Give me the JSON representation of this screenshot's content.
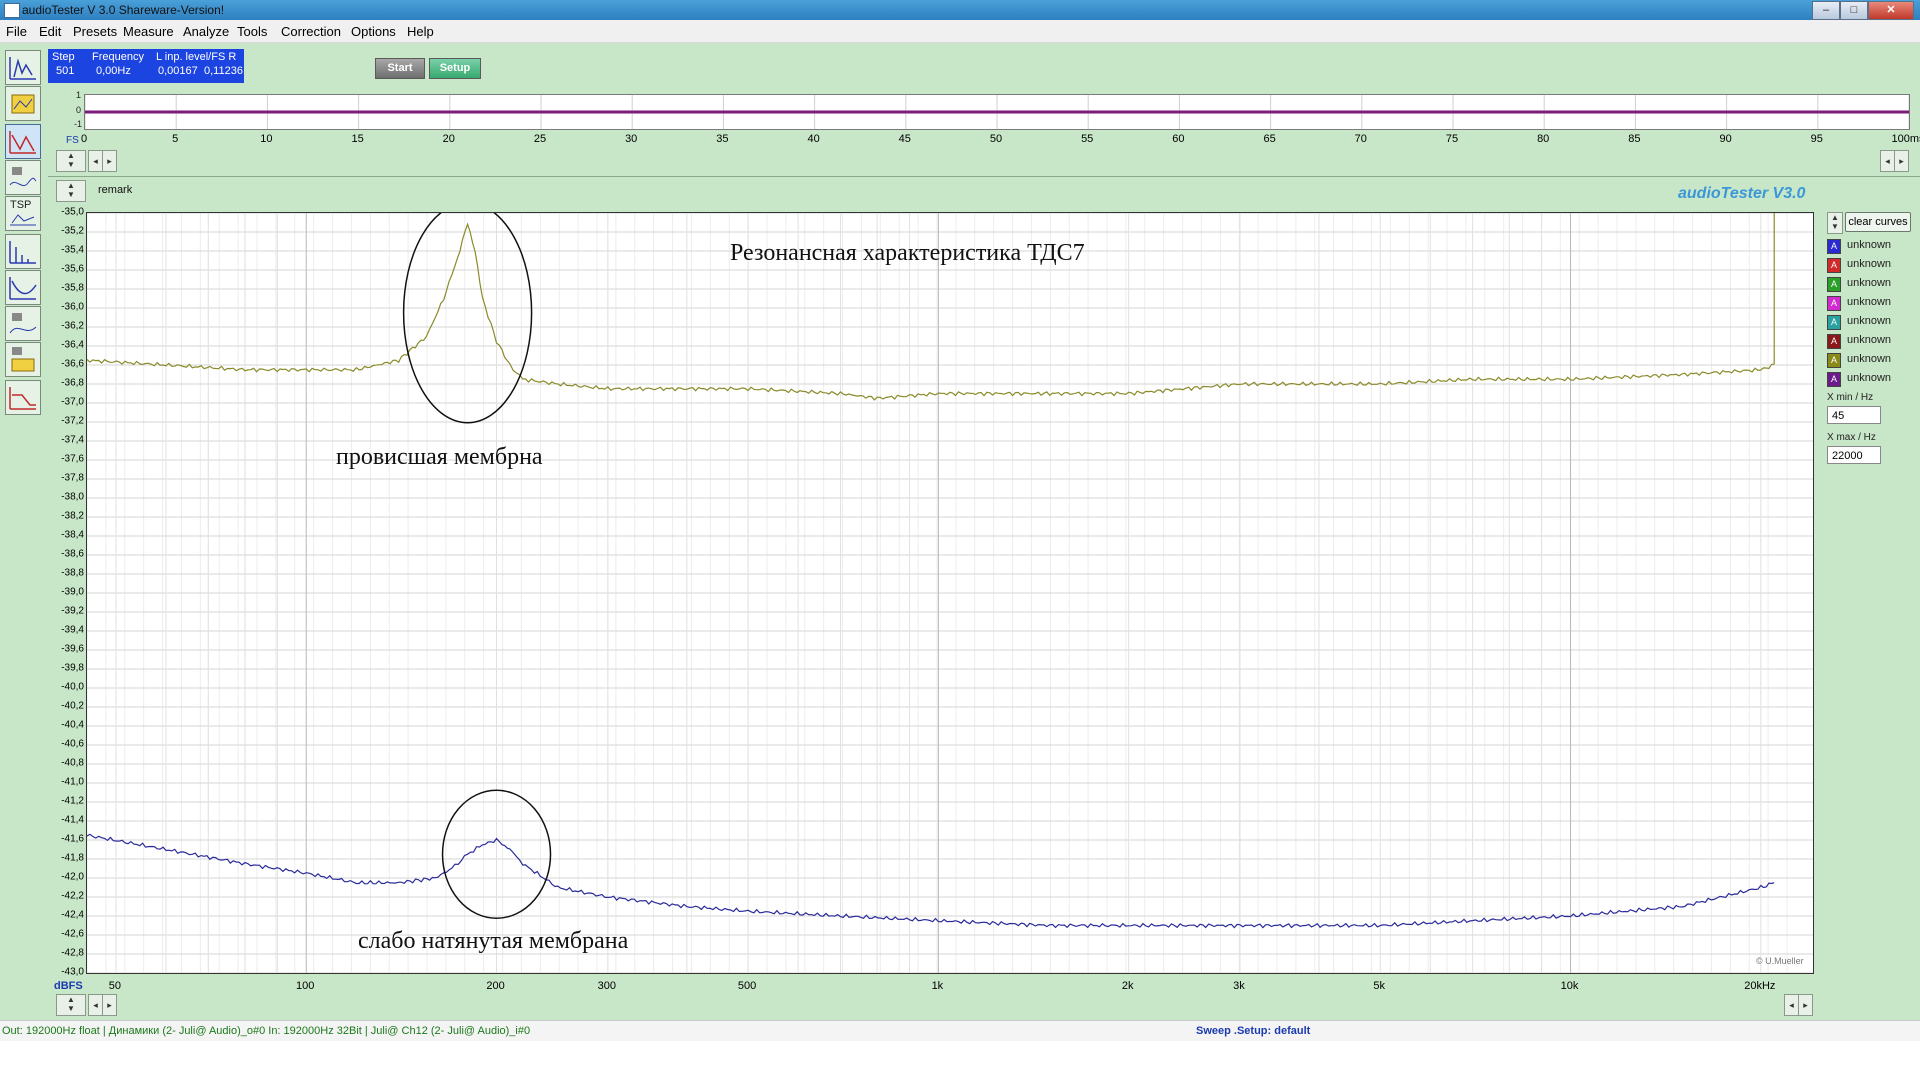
{
  "window": {
    "title": "audioTester  V 3.0 Shareware-Version!",
    "minimize": "–",
    "maximize": "□",
    "close": "✕"
  },
  "menu": [
    "File",
    "Edit",
    "Presets",
    "Measure",
    "Analyze",
    "Tools",
    "Correction",
    "Options",
    "Help"
  ],
  "toolbar_left": {
    "tsp_label": "TSP"
  },
  "info": {
    "step_label": "Step",
    "step_value": "501",
    "freq_label": "Frequency",
    "freq_value": "0,00Hz",
    "level_label": "L  inp. level/FS  R",
    "level_l": "0,00167",
    "level_r": "0,11236"
  },
  "buttons": {
    "start": "Start",
    "setup": "Setup"
  },
  "scope": {
    "y_top": "1",
    "y_mid": "0",
    "y_bottom": "-1",
    "fs_label": "FS",
    "time_ticks": [
      "0",
      "5",
      "10",
      "15",
      "20",
      "25",
      "30",
      "35",
      "40",
      "45",
      "50",
      "55",
      "60",
      "65",
      "70",
      "75",
      "80",
      "85",
      "90",
      "95",
      "100ms"
    ]
  },
  "remark": "remark",
  "brand": "audioTester  V3.0",
  "chart_data": {
    "type": "line",
    "title": "Резонансная характеристика ТДС7",
    "xlabel": "",
    "ylabel": "dBFS",
    "x_scale": "log",
    "xlim": [
      45,
      22000
    ],
    "ylim": [
      -43.0,
      -35.0
    ],
    "x_tick_labels": [
      "50",
      "100",
      "200",
      "300",
      "500",
      "1k",
      "2k",
      "3k",
      "5k",
      "10k",
      "20kHz"
    ],
    "x_tick_values": [
      50,
      100,
      200,
      300,
      500,
      1000,
      2000,
      3000,
      5000,
      10000,
      20000
    ],
    "y_tick_labels": [
      "-35,0",
      "-35,2",
      "-35,4",
      "-35,6",
      "-35,8",
      "-36,0",
      "-36,2",
      "-36,4",
      "-36,6",
      "-36,8",
      "-37,0",
      "-37,2",
      "-37,4",
      "-37,6",
      "-37,8",
      "-38,0",
      "-38,2",
      "-38,4",
      "-38,6",
      "-38,8",
      "-39,0",
      "-39,2",
      "-39,4",
      "-39,6",
      "-39,8",
      "-40,0",
      "-40,2",
      "-40,4",
      "-40,6",
      "-40,8",
      "-41,0",
      "-41,2",
      "-41,4",
      "-41,6",
      "-41,8",
      "-42,0",
      "-42,2",
      "-42,4",
      "-42,6",
      "-42,8",
      "-43,0"
    ],
    "series": [
      {
        "color": "#8a8a2a",
        "x": [
          45,
          60,
          80,
          100,
          120,
          140,
          155,
          165,
          175,
          180,
          185,
          190,
          200,
          210,
          220,
          250,
          300,
          400,
          500,
          700,
          800,
          1000,
          1500,
          2000,
          3000,
          5000,
          7000,
          10000,
          15000,
          20000,
          21000,
          21000
        ],
        "y": [
          -36.55,
          -36.6,
          -36.65,
          -36.65,
          -36.65,
          -36.55,
          -36.3,
          -35.9,
          -35.4,
          -35.1,
          -35.4,
          -35.9,
          -36.35,
          -36.6,
          -36.75,
          -36.8,
          -36.85,
          -36.85,
          -36.85,
          -36.9,
          -36.95,
          -36.9,
          -36.9,
          -36.9,
          -36.8,
          -36.8,
          -36.75,
          -36.75,
          -36.7,
          -36.65,
          -36.6,
          -35.0
        ]
      },
      {
        "color": "#2a2a9a",
        "x": [
          45,
          60,
          80,
          100,
          120,
          140,
          160,
          170,
          180,
          190,
          200,
          210,
          220,
          250,
          300,
          400,
          500,
          700,
          1000,
          1500,
          2000,
          3000,
          5000,
          7000,
          10000,
          15000,
          20000,
          21000
        ],
        "y": [
          -41.55,
          -41.7,
          -41.85,
          -41.95,
          -42.05,
          -42.05,
          -42.0,
          -41.9,
          -41.75,
          -41.65,
          -41.6,
          -41.7,
          -41.85,
          -42.1,
          -42.2,
          -42.3,
          -42.35,
          -42.4,
          -42.45,
          -42.5,
          -42.5,
          -42.5,
          -42.5,
          -42.45,
          -42.4,
          -42.3,
          -42.1,
          -42.05
        ]
      }
    ]
  },
  "annotations": {
    "sagging": "провисшая мембрна",
    "loose": "слабо натянутая мембрана"
  },
  "right_panel": {
    "clear_curves": "clear curves",
    "curves": [
      {
        "name": "unknown",
        "color": "#2a2ad0",
        "letter": "A"
      },
      {
        "name": "unknown",
        "color": "#d02a2a",
        "letter": "A"
      },
      {
        "name": "unknown",
        "color": "#2aa02a",
        "letter": "A"
      },
      {
        "name": "unknown",
        "color": "#d02ad0",
        "letter": "A"
      },
      {
        "name": "unknown",
        "color": "#2aa0a0",
        "letter": "A"
      },
      {
        "name": "unknown",
        "color": "#8a1a1a",
        "letter": "A"
      },
      {
        "name": "unknown",
        "color": "#8a8a1a",
        "letter": "A"
      },
      {
        "name": "unknown",
        "color": "#6a1a8a",
        "letter": "A"
      }
    ],
    "xmin_label": "X min / Hz",
    "xmin_value": "45",
    "xmax_label": "X max / Hz",
    "xmax_value": "22000"
  },
  "copyright": "© U.Mueller",
  "status": {
    "left": "Out: 192000Hz float  | Динамики (2- Juli@ Audio)_o#0  In: 192000Hz 32Bit  | Juli@ Ch12 (2- Juli@ Audio)_i#0",
    "mid": "Sweep  .Setup:  default"
  }
}
